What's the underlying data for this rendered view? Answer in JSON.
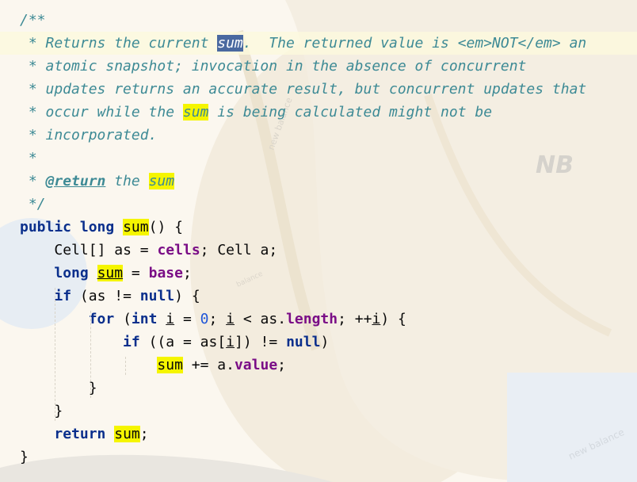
{
  "editor": {
    "language": "java",
    "caret_line": 1,
    "highlighted_symbol": "sum",
    "lines": [
      "/**",
      " * Returns the current sum.  The returned value is <em>NOT</em> an",
      " * atomic snapshot; invocation in the absence of concurrent",
      " * updates returns an accurate result, but concurrent updates that",
      " * occur while the sum is being calculated might not be",
      " * incorporated.",
      " *",
      " * @return the sum",
      " */",
      "public long sum() {",
      "    Cell[] as = cells; Cell a;",
      "    long sum = base;",
      "    if (as != null) {",
      "        for (int i = 0; i < as.length; ++i) {",
      "            if ((a = as[i]) != null)",
      "                sum += a.value;",
      "        }",
      "    }",
      "    return sum;",
      "}"
    ]
  },
  "background": {
    "wallpaper_text": [
      "new balance",
      "balance"
    ],
    "logo_text": "NB"
  },
  "colors": {
    "keyword": "#0a2f8c",
    "field": "#7a0d86",
    "doc_comment": "#3d8a95",
    "number": "#1e55d8",
    "identifier_highlight": "#f5f500",
    "selection": "#4a69a0",
    "caret_line": "#fcfadc"
  }
}
